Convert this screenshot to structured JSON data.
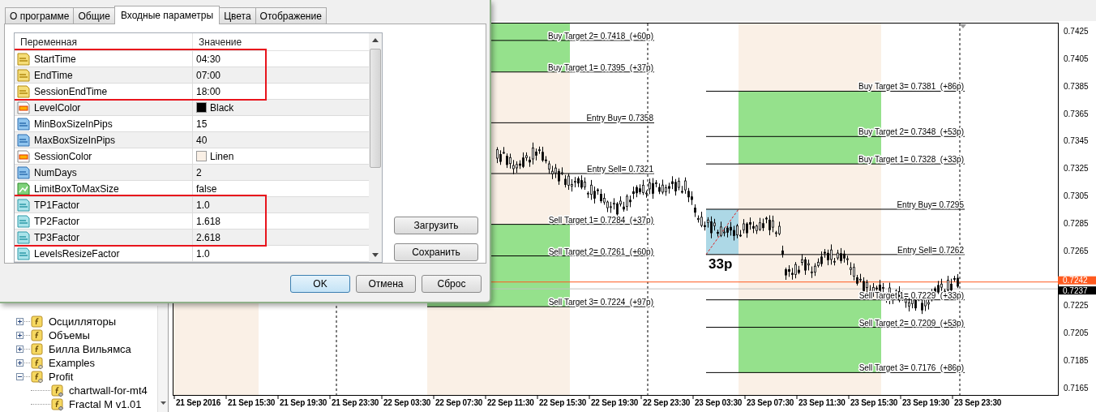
{
  "dialog": {
    "tabs": [
      {
        "label": "О программе",
        "selected": false
      },
      {
        "label": "Общие",
        "selected": false
      },
      {
        "label": "Входные параметры",
        "selected": true
      },
      {
        "label": "Цвета",
        "selected": false
      },
      {
        "label": "Отображение",
        "selected": false
      }
    ],
    "columns": [
      "Переменная",
      "Значение"
    ],
    "params": [
      {
        "name": "StartTime",
        "value": "04:30",
        "kind": "string",
        "highlighted": true
      },
      {
        "name": "EndTime",
        "value": "07:00",
        "kind": "string",
        "highlighted": true
      },
      {
        "name": "SessionEndTime",
        "value": "18:00",
        "kind": "string",
        "highlighted": true
      },
      {
        "name": "LevelColor",
        "value": "Black",
        "kind": "color",
        "color": "#000000",
        "highlighted": false
      },
      {
        "name": "MinBoxSizeInPips",
        "value": "15",
        "kind": "int",
        "highlighted": false
      },
      {
        "name": "MaxBoxSizeInPips",
        "value": "40",
        "kind": "int",
        "highlighted": false
      },
      {
        "name": "SessionColor",
        "value": "Linen",
        "kind": "color",
        "color": "#faf0e6",
        "highlighted": false
      },
      {
        "name": "NumDays",
        "value": "2",
        "kind": "int",
        "highlighted": false
      },
      {
        "name": "LimitBoxToMaxSize",
        "value": "false",
        "kind": "bool",
        "highlighted": false
      },
      {
        "name": "TP1Factor",
        "value": "1.0",
        "kind": "double",
        "highlighted": true
      },
      {
        "name": "TP2Factor",
        "value": "1.618",
        "kind": "double",
        "highlighted": true
      },
      {
        "name": "TP3Factor",
        "value": "2.618",
        "kind": "double",
        "highlighted": true
      },
      {
        "name": "LevelsResizeFactor",
        "value": "1.0",
        "kind": "double",
        "highlighted": false
      }
    ],
    "side_buttons": [
      "Загрузить",
      "Сохранить"
    ],
    "buttons": [
      {
        "label": "OK",
        "default": true
      },
      {
        "label": "Отмена",
        "default": false
      },
      {
        "label": "Сброс",
        "default": false
      }
    ]
  },
  "navigator": {
    "items": [
      {
        "label": "Осцилляторы",
        "kind": "folder",
        "expanded": false
      },
      {
        "label": "Объемы",
        "kind": "folder",
        "expanded": false
      },
      {
        "label": "Билла Вильямса",
        "kind": "folder",
        "expanded": false
      },
      {
        "label": "Examples",
        "kind": "folder-special",
        "expanded": false
      },
      {
        "label": "Profit",
        "kind": "folder-special",
        "expanded": true,
        "children": [
          {
            "label": "chartwall-for-mt4",
            "kind": "indicator"
          },
          {
            "label": "Fractal M v1.01",
            "kind": "indicator"
          }
        ]
      }
    ]
  },
  "chart": {
    "levels": [
      {
        "label": "Buy Target 2= 0.7418  (+60p)"
      },
      {
        "label": "Buy Target 1= 0.7395  (+37p)"
      },
      {
        "label": "Entry Buy= 0.7358"
      },
      {
        "label": "Entry Sell= 0.7321"
      },
      {
        "label": "Sell Target 1= 0.7284  (+37p)"
      },
      {
        "label": "Sell Target 2= 0.7261  (+60p)"
      },
      {
        "label": "Sell Target 3= 0.7224  (+97p)"
      },
      {
        "label": "Buy Target 3= 0.7381  (+86p)"
      },
      {
        "label": "Buy Target 2= 0.7348  (+53p)"
      },
      {
        "label": "Buy Target 1= 0.7328  (+33p)"
      },
      {
        "label": "Entry Buy= 0.7295"
      },
      {
        "label": "Entry Sell= 0.7262"
      },
      {
        "label": "Sell Target 1= 0.7229  (+33p)"
      },
      {
        "label": "Sell Target 2= 0.7209  (+53p)"
      },
      {
        "label": "Sell Target 3= 0.7176  (+86p)"
      }
    ],
    "box_label": "33p",
    "price_labels": [
      "0.7425",
      "0.7405",
      "0.7385",
      "0.7365",
      "0.7345",
      "0.7325",
      "0.7305",
      "0.7285",
      "0.7265",
      "0.7225",
      "0.7205",
      "0.7185",
      "0.7165"
    ],
    "price_tags": [
      {
        "text": "0.7242",
        "kind": "bid"
      },
      {
        "text": "0.7237",
        "kind": "last"
      }
    ],
    "time_labels": [
      "21 Sep 2016",
      "21 Sep 15:30",
      "21 Sep 19:30",
      "21 Sep 23:30",
      "22 Sep 03:30",
      "22 Sep 07:30",
      "22 Sep 11:30",
      "22 Sep 15:30",
      "22 Sep 19:30",
      "22 Sep 23:30",
      "23 Sep 03:30",
      "23 Sep 07:30",
      "23 Sep 11:30",
      "23 Sep 15:30",
      "23 Sep 19:30",
      "23 Sep 23:30"
    ]
  }
}
